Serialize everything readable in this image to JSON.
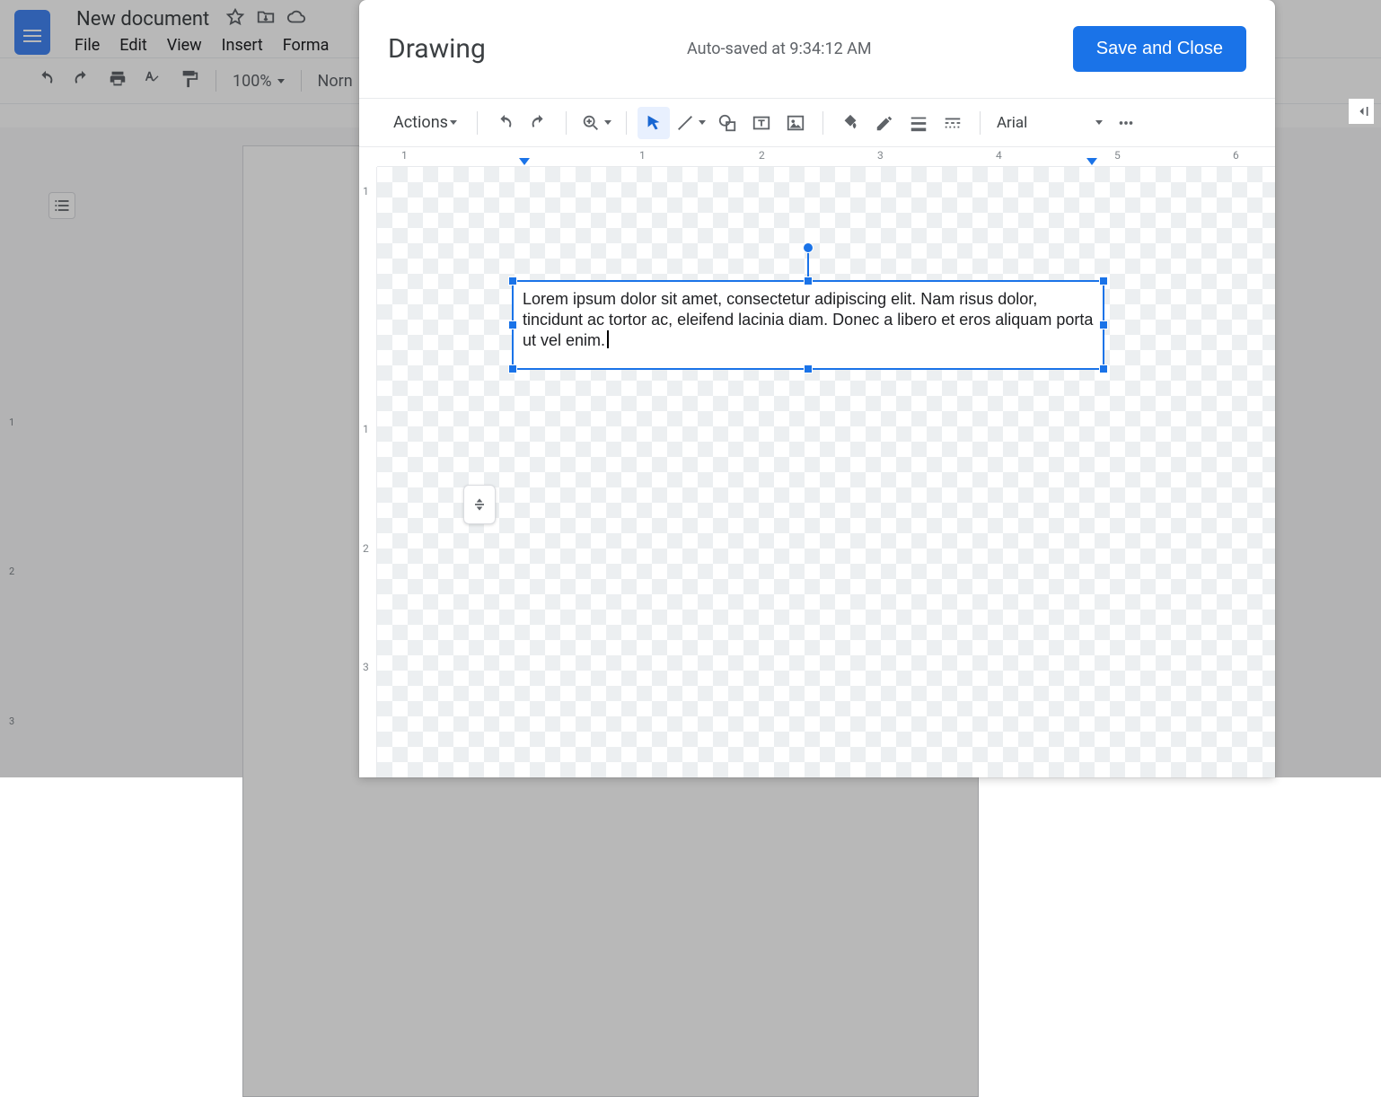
{
  "docs": {
    "title": "New document",
    "menus": [
      "File",
      "Edit",
      "View",
      "Insert",
      "Forma"
    ],
    "toolbar_zoom": "100%",
    "toolbar_style": "Norn",
    "vruler": [
      "",
      "1",
      "2",
      "3"
    ]
  },
  "modal": {
    "title": "Drawing",
    "status": "Auto-saved at 9:34:12 AM",
    "save_label": "Save and Close",
    "actions_label": "Actions",
    "font": "Arial",
    "hruler_numbers": [
      "1",
      "1",
      "2",
      "3",
      "4",
      "5",
      "6"
    ],
    "vruler_numbers": [
      "1",
      "1",
      "2",
      "3"
    ],
    "textbox_text": "Lorem ipsum dolor sit amet, consectetur adipiscing elit. Nam risus dolor, tincidunt ac tortor ac, eleifend lacinia diam. Donec a libero et eros aliquam porta ut vel enim."
  }
}
